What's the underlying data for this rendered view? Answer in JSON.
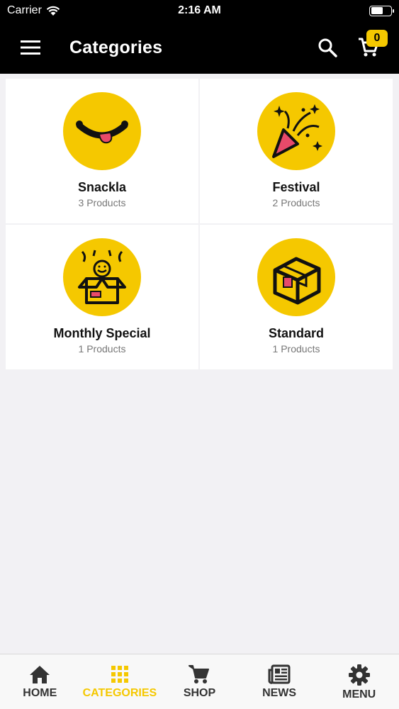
{
  "status_bar": {
    "carrier": "Carrier",
    "time": "2:16 AM"
  },
  "nav": {
    "title": "Categories",
    "menu_icon": "hamburger-icon",
    "search_icon": "search-icon",
    "cart_icon": "cart-icon",
    "cart_count": "0"
  },
  "categories": [
    {
      "name": "Snackla",
      "count": "3 Products",
      "icon": "tongue-smile-icon"
    },
    {
      "name": "Festival",
      "count": "2 Products",
      "icon": "party-popper-icon"
    },
    {
      "name": "Monthly Special",
      "count": "1 Products",
      "icon": "surprise-box-icon"
    },
    {
      "name": "Standard",
      "count": "1 Products",
      "icon": "package-box-icon"
    }
  ],
  "tabs": [
    {
      "label": "HOME",
      "icon": "home-icon"
    },
    {
      "label": "CATEGORIES",
      "icon": "grid-icon",
      "active": true
    },
    {
      "label": "SHOP",
      "icon": "cart-icon"
    },
    {
      "label": "NEWS",
      "icon": "newspaper-icon"
    },
    {
      "label": "MENU",
      "icon": "gear-icon"
    }
  ],
  "colors": {
    "accent": "#f5c800",
    "bar": "#000000",
    "background": "#f2f1f4"
  }
}
